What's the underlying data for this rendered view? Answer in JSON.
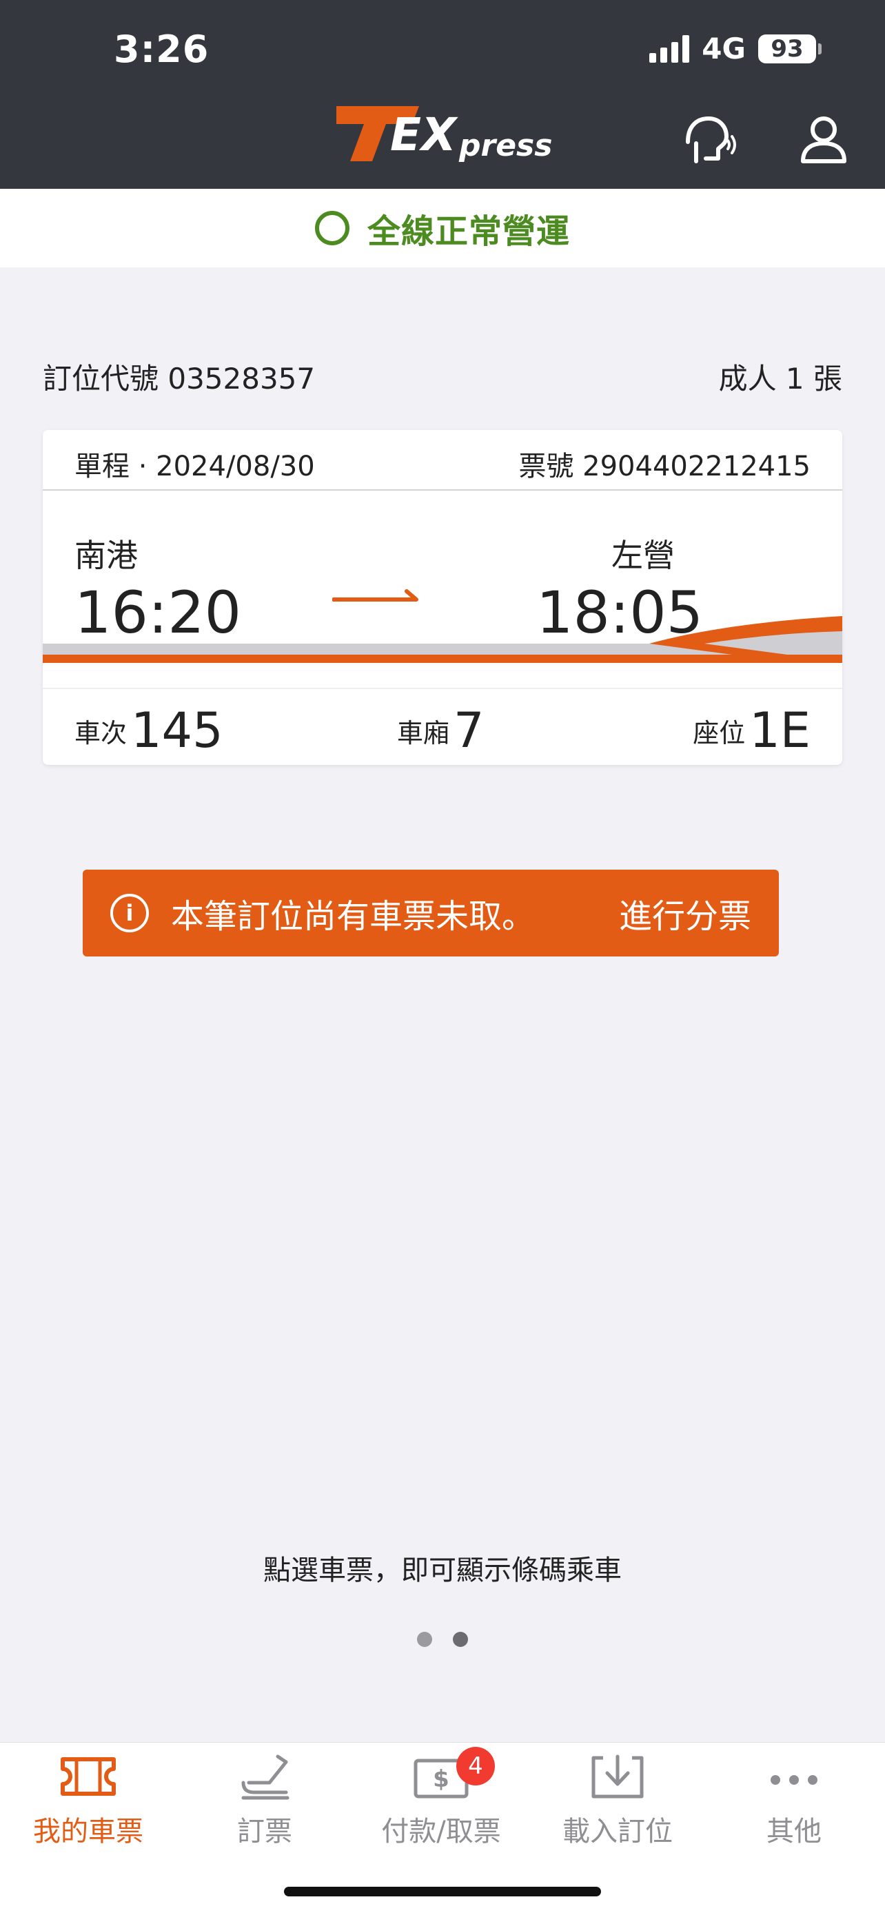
{
  "status_bar": {
    "time": "3:26",
    "network": "4G",
    "battery": "93"
  },
  "header": {
    "logo_icon": "texpress-logo",
    "support_icon": "voice-support-icon",
    "account_icon": "user-icon"
  },
  "operation_status": {
    "text": "全線正常營運",
    "color": "#4b8b1f"
  },
  "reservation": {
    "code_label": "訂位代號 03528357",
    "passengers": "成人 1 張"
  },
  "ticket": {
    "trip_date": "單程 · 2024/08/30",
    "ticket_number": "票號 2904402212415",
    "from_station": "南港",
    "from_time": "16:20",
    "to_station": "左營",
    "to_time": "18:05",
    "train_label": "車次",
    "train_value": "145",
    "coach_label": "車廂",
    "coach_value": "7",
    "seat_label": "座位",
    "seat_value": "1E"
  },
  "alert": {
    "message": "本筆訂位尚有車票未取。",
    "action": "進行分票",
    "color": "#e35c15"
  },
  "hint": "點選車票，即可顯示條碼乘車",
  "pager": {
    "total": 2,
    "current": 2
  },
  "bottom_nav": [
    {
      "label": "我的車票",
      "icon": "ticket-icon",
      "active": true
    },
    {
      "label": "訂票",
      "icon": "seat-icon"
    },
    {
      "label": "付款/取票",
      "icon": "payment-icon",
      "badge": "4"
    },
    {
      "label": "載入訂位",
      "icon": "download-icon"
    },
    {
      "label": "其他",
      "icon": "more-icon"
    }
  ],
  "brand_colors": {
    "accent": "#e35c15",
    "header": "#34373d"
  }
}
